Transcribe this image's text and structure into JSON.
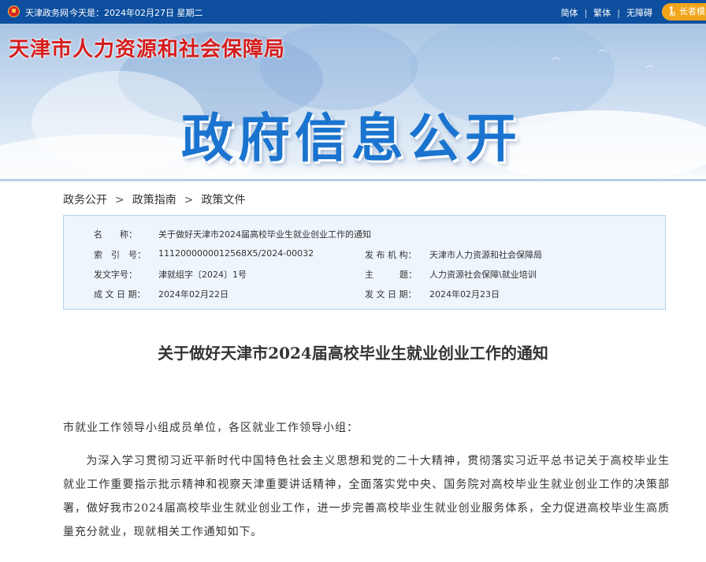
{
  "topbar": {
    "portal": "天津政务网",
    "today_label": "今天是：",
    "date": "2024年02月27日",
    "weekday": "星期二",
    "links": [
      "简体",
      "繁体",
      "无障碍"
    ],
    "elder_mode": "长者模式"
  },
  "banner": {
    "agency_name": "天津市人力资源和社会保障局",
    "page_heading": "政府信息公开"
  },
  "breadcrumb": [
    "政务公开",
    "政策指南",
    "政策文件"
  ],
  "breadcrumb_sep": ">",
  "info": {
    "name_label": "名　　称：",
    "name_value": "关于做好天津市2024届高校毕业生就业创业工作的通知",
    "index_label": "索　引　号：",
    "index_value": "1112000000012568X5/2024-00032",
    "issuer_label": "发 布 机 构：",
    "issuer_value": "天津市人力资源和社会保障局",
    "docno_label": "发文字号：",
    "docno_value": "津就组字〔2024〕1号",
    "topic_label": "主　　　题：",
    "topic_value": "人力资源社会保障\\就业培训",
    "created_label": "成 文 日 期：",
    "created_value": "2024年02月22日",
    "published_label": "发 文 日 期：",
    "published_value": "2024年02月23日"
  },
  "article": {
    "title": "关于做好天津市2024届高校毕业生就业创业工作的通知",
    "salutation": "市就业工作领导小组成员单位，各区就业工作领导小组：",
    "paragraph": "为深入学习贯彻习近平新时代中国特色社会主义思想和党的二十大精神，贯彻落实习近平总书记关于高校毕业生就业工作重要指示批示精神和视察天津重要讲话精神，全面落实党中央、国务院对高校毕业生就业创业工作的决策部署，做好我市2024届高校毕业生就业创业工作，进一步完善高校毕业生就业创业服务体系，全力促进高校毕业生高质量充分就业，现就相关工作通知如下。"
  },
  "colors": {
    "topbar": "#0d4f9e",
    "agency_red": "#d51d1d",
    "heading_blue": "#1a74cf",
    "elder_orange": "#f2a51b",
    "infobox_bg": "#eef5fc"
  }
}
